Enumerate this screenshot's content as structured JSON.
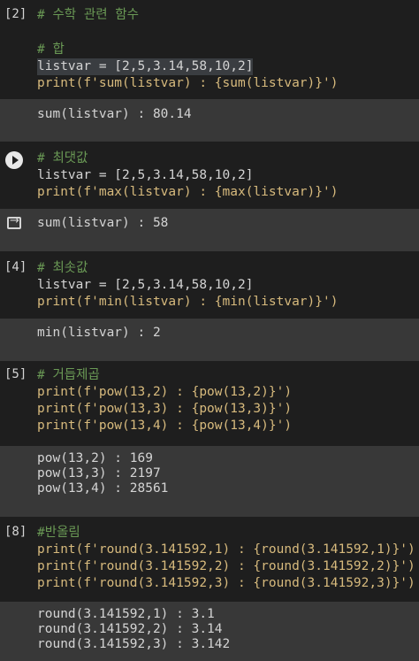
{
  "cells": [
    {
      "label": "[2]",
      "lines": [
        "# 수학 관련 함수",
        "",
        "# 합",
        "listvar = [2,5,3.14,58,10,2]",
        "print(f'sum(listvar) : {sum(listvar)}')"
      ],
      "output": [
        "sum(listvar) : 80.14"
      ]
    },
    {
      "label": "",
      "lines": [
        "# 최댓값",
        "listvar = [2,5,3.14,58,10,2]",
        "print(f'max(listvar) : {max(listvar)}')"
      ],
      "output": [
        "sum(listvar) : 58"
      ]
    },
    {
      "label": "[4]",
      "lines": [
        "# 최솟값",
        "listvar = [2,5,3.14,58,10,2]",
        "print(f'min(listvar) : {min(listvar)}')"
      ],
      "output": [
        "min(listvar) : 2"
      ]
    },
    {
      "label": "[5]",
      "lines": [
        "# 거듭제곱",
        "print(f'pow(13,2) : {pow(13,2)}')",
        "print(f'pow(13,3) : {pow(13,3)}')",
        "print(f'pow(13,4) : {pow(13,4)}')"
      ],
      "output": [
        "pow(13,2) : 169",
        "pow(13,3) : 2197",
        "pow(13,4) : 28561"
      ]
    },
    {
      "label": "[8]",
      "lines": [
        "#반올림",
        "print(f'round(3.141592,1) : {round(3.141592,1)}')",
        "print(f'round(3.141592,2) : {round(3.141592,2)}')",
        "print(f'round(3.141592,3) : {round(3.141592,3)}')"
      ],
      "output": [
        "round(3.141592,1) : 3.1",
        "round(3.141592,2) : 3.14",
        "round(3.141592,3) : 3.142"
      ]
    }
  ],
  "icons": {
    "run": "play-icon",
    "output": "output-redirect-icon"
  }
}
